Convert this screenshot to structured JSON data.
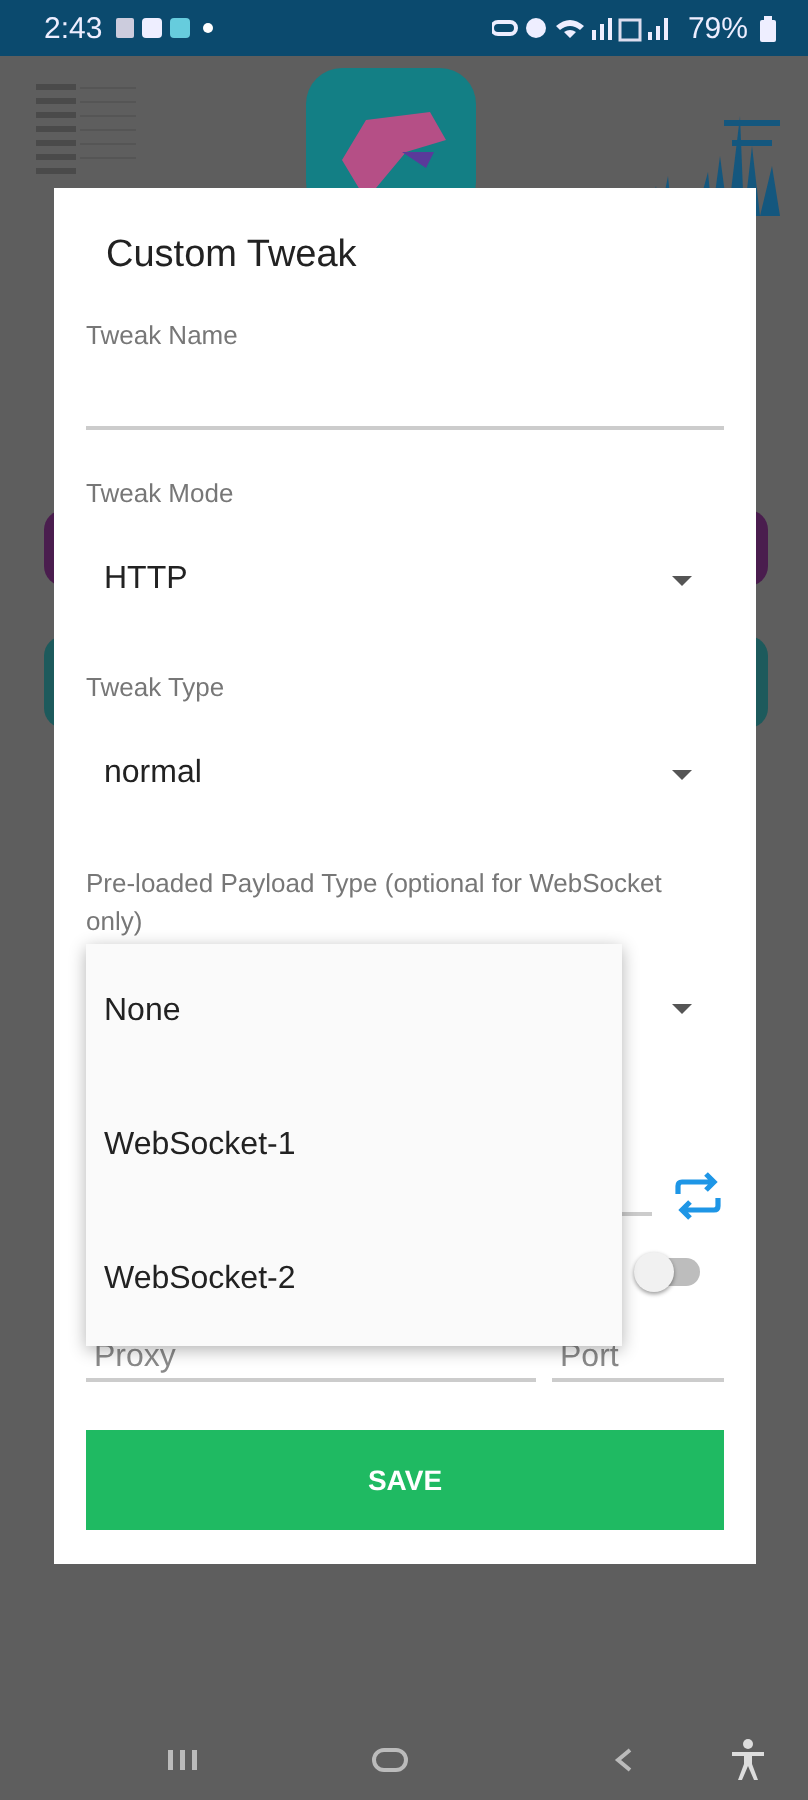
{
  "status_bar": {
    "time": "2:43",
    "battery": "79%"
  },
  "dialog": {
    "title": "Custom Tweak",
    "fields": [
      {
        "kind": "text",
        "label": "Tweak Name"
      },
      {
        "kind": "dropdown",
        "label": "Tweak Mode",
        "value": "HTTP"
      },
      {
        "kind": "dropdown",
        "label": "Tweak Type",
        "value": "normal"
      },
      {
        "kind": "dropdown",
        "label": "Pre-loaded Payload Type (optional for WebSocket only)"
      }
    ],
    "toggle": {
      "on": false
    },
    "proxy": {
      "placeholder": "Proxy"
    },
    "port": {
      "placeholder": "Port"
    },
    "save_button": "SAVE"
  },
  "dropdown_menu": {
    "options": [
      {
        "label": "None"
      },
      {
        "label": "WebSocket-1"
      },
      {
        "label": "WebSocket-2"
      }
    ]
  }
}
